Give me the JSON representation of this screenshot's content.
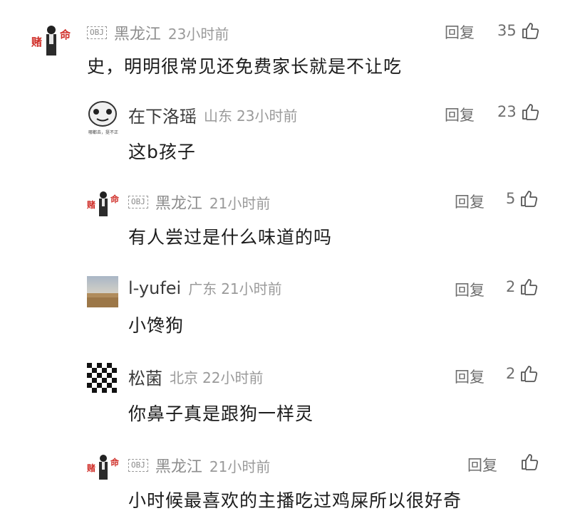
{
  "comments": [
    {
      "name": "黑龙江",
      "location": "",
      "time": "23小时前",
      "badge": "OBJ",
      "text": "史，明明很常见还免费家长就是不让吃",
      "reply": "回复",
      "likes": "35"
    },
    {
      "name": "在下洛瑶",
      "location": "山东",
      "time": "23小时前",
      "badge": "",
      "text": "这b孩子",
      "reply": "回复",
      "likes": "23",
      "avatar_caption": "哪都去，挺不正常"
    },
    {
      "name": "黑龙江",
      "location": "",
      "time": "21小时前",
      "badge": "OBJ",
      "text": "有人尝过是什么味道的吗",
      "reply": "回复",
      "likes": "5"
    },
    {
      "name": "l-yufei",
      "location": "广东",
      "time": "21小时前",
      "badge": "",
      "text": "小馋狗",
      "reply": "回复",
      "likes": "2"
    },
    {
      "name": "松菌",
      "location": "北京",
      "time": "22小时前",
      "badge": "",
      "text": "你鼻子真是跟狗一样灵",
      "reply": "回复",
      "likes": "2"
    },
    {
      "name": "黑龙江",
      "location": "",
      "time": "21小时前",
      "badge": "OBJ",
      "text": "小时候最喜欢的主播吃过鸡屎所以很好奇",
      "reply": "回复",
      "likes": ""
    }
  ],
  "colors": {
    "text": "#1c1c1c",
    "muted": "#9a9a9a",
    "accent": "#d0302a"
  },
  "icons": {
    "like": "thumbs-up-icon"
  }
}
